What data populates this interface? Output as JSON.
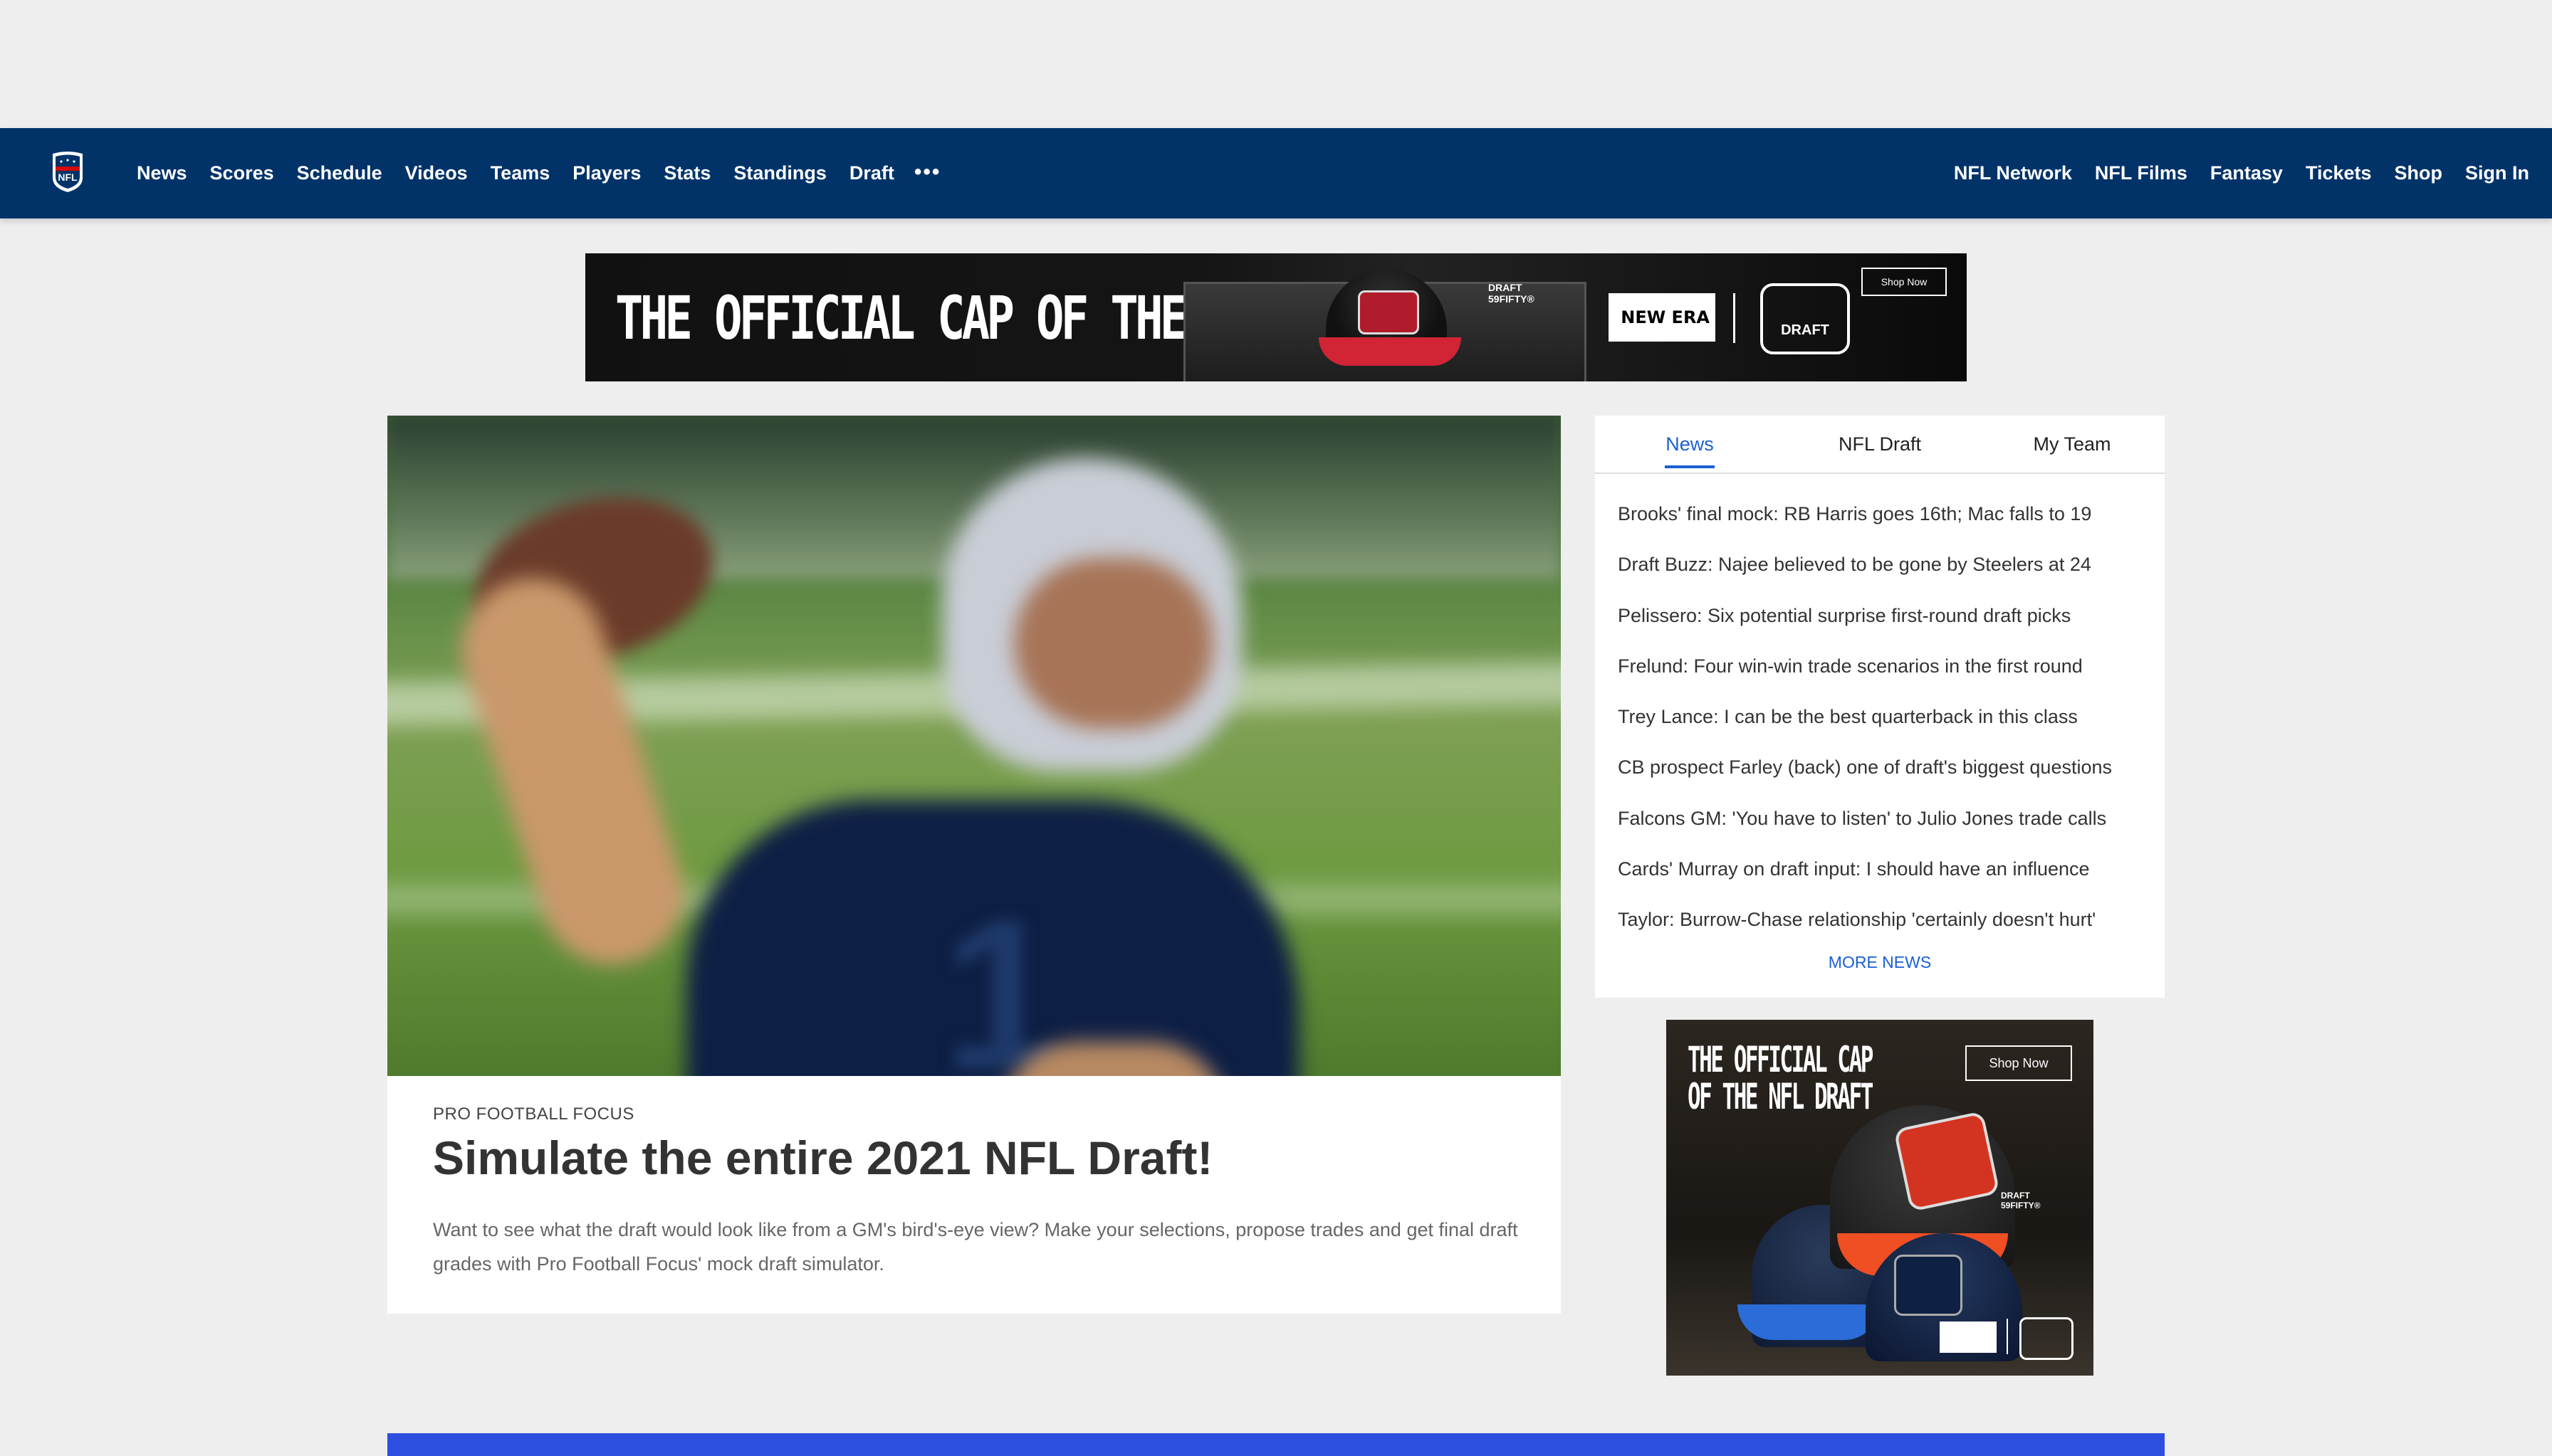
{
  "nav": {
    "left_items": [
      "News",
      "Scores",
      "Schedule",
      "Videos",
      "Teams",
      "Players",
      "Stats",
      "Standings",
      "Draft"
    ],
    "more_label": "•••",
    "right_items": [
      "NFL Network",
      "NFL Films",
      "Fantasy",
      "Tickets",
      "Shop",
      "Sign In"
    ],
    "logo_text": "NFL",
    "background_color": "#013369"
  },
  "top_ad": {
    "headline": "THE OFFICIAL CAP OF THE NFL DRAFT",
    "cap_label": "DRAFT 59FIFTY®",
    "brand": "NEW ERA",
    "badge": "DRAFT",
    "cta": "Shop Now"
  },
  "hero": {
    "eyebrow": "PRO FOOTBALL FOCUS",
    "title": "Simulate the entire 2021 NFL Draft!",
    "description": "Want to see what the draft would look like from a GM's bird's-eye view? Make your selections, propose trades and get final draft grades with Pro Football Focus' mock draft simulator."
  },
  "news_panel": {
    "tabs": [
      "News",
      "NFL Draft",
      "My Team"
    ],
    "active_tab": "News",
    "items": [
      "Brooks' final mock: RB Harris goes 16th; Mac falls to 19",
      "Draft Buzz: Najee believed to be gone by Steelers at 24",
      "Pelissero: Six potential surprise first-round draft picks",
      "Frelund: Four win-win trade scenarios in the first round",
      "Trey Lance: I can be the best quarterback in this class",
      "CB prospect Farley (back) one of draft's biggest questions",
      "Falcons GM: 'You have to listen' to Julio Jones trade calls",
      "Cards' Murray on draft input: I should have an influence",
      "Taylor: Burrow-Chase relationship 'certainly doesn't hurt'"
    ],
    "more_label": "MORE NEWS",
    "accent_color": "#1a5fd4"
  },
  "side_ad": {
    "headline_line1": "THE OFFICIAL CAP",
    "headline_line2": "OF THE NFL DRAFT",
    "cta": "Shop Now",
    "cap_label": "DRAFT 59FIFTY®"
  }
}
